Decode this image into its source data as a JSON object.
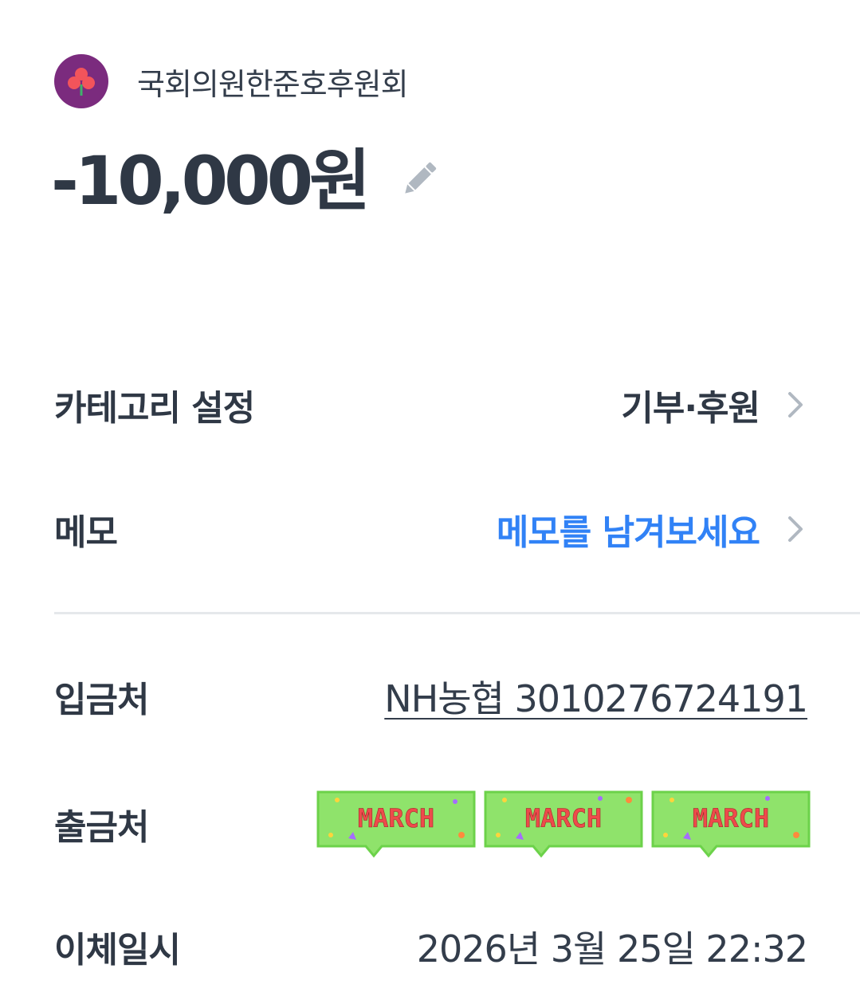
{
  "header": {
    "recipient": "국회의원한준호후원회",
    "avatar_color": "#7b2b7e",
    "avatar_icon": "clover-flower-icon"
  },
  "amount": {
    "value": "-10,000원",
    "edit_icon": "pencil-icon"
  },
  "rows": {
    "category": {
      "label": "카테고리 설정",
      "value": "기부·후원"
    },
    "memo": {
      "label": "메모",
      "value": "메모를 남겨보세요"
    },
    "deposit_to": {
      "label": "입금처",
      "value": "NH농협 3010276724191"
    },
    "withdraw_from": {
      "label": "출금처",
      "stickers": [
        "MARCH",
        "MARCH",
        "MARCH"
      ]
    },
    "transfer_date": {
      "label": "이체일시",
      "value": "2026년 3월 25일 22:32"
    }
  },
  "colors": {
    "accent": "#3182f6",
    "text_primary": "#2f3845",
    "divider": "#e5e8eb",
    "sticker_bg": "#8fe36b",
    "sticker_text": "#ee4b4b"
  }
}
